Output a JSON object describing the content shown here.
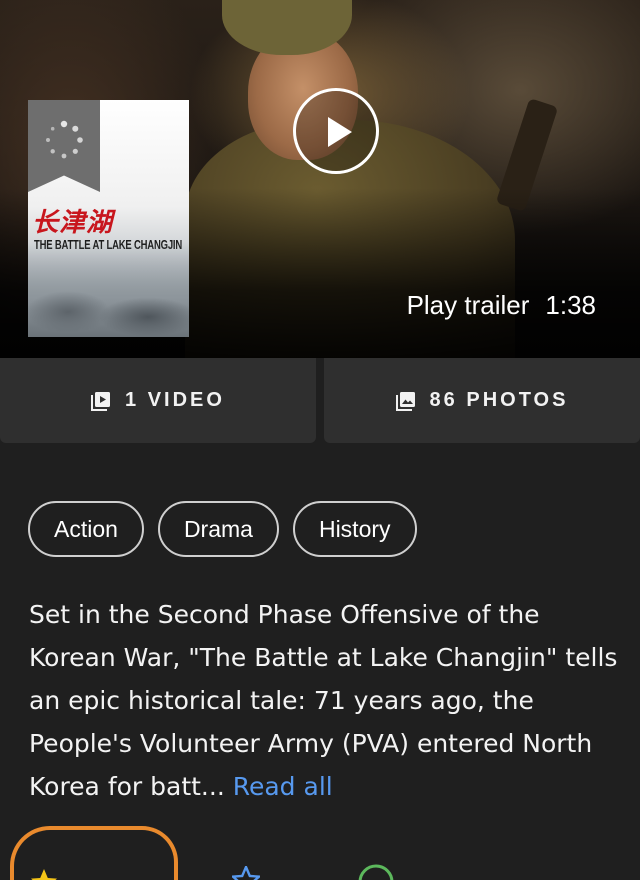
{
  "hero": {
    "trailer_label": "Play trailer",
    "trailer_duration": "1:38",
    "play_icon": "play-circle-icon"
  },
  "poster": {
    "title_cn": "长津湖",
    "title_en": "THE BATTLE AT LAKE CHANGJIN",
    "loading_icon": "spinner-icon"
  },
  "media": {
    "videos_label": "1 VIDEO",
    "videos_icon": "video-library-icon",
    "photos_label": "86 PHOTOS",
    "photos_icon": "photo-library-icon"
  },
  "genres": [
    "Action",
    "Drama",
    "History"
  ],
  "plot": {
    "text": "Set in the Second Phase Offensive of the Korean War, \"The Battle at Lake Changjin\" tells an epic historical tale: 71 years ago, the People's Volunteer Army (PVA) entered North Korea for batt... ",
    "read_more": "Read all"
  },
  "colors": {
    "background": "#1f1f1f",
    "panel": "#2f2f2f",
    "link": "#5799ef",
    "highlight": "#e98a2d",
    "star": "#f5c518"
  }
}
